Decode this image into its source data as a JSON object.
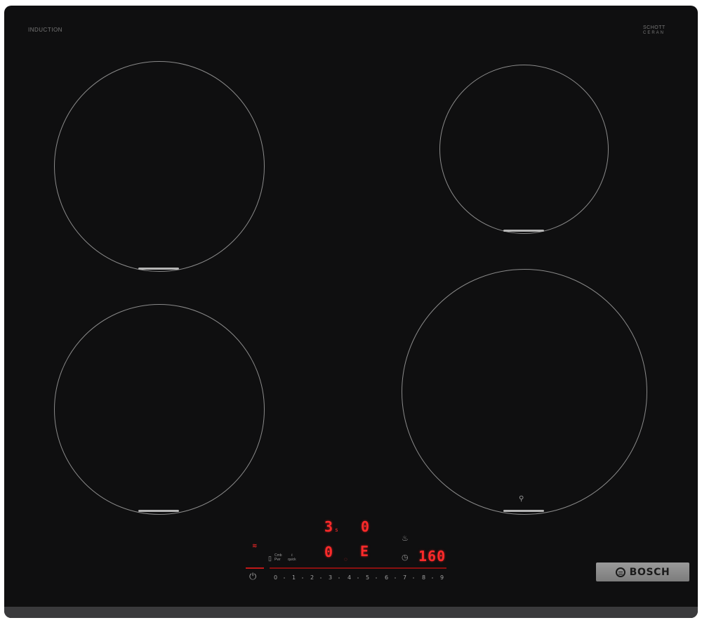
{
  "top_labels": {
    "left": "INDUCTION",
    "right_line1": "SCHOTT",
    "right_line2": "CERAN"
  },
  "displays": {
    "timer_left": "3",
    "timer_left_sub": "s",
    "timer_right": "0",
    "zone_level": "0",
    "error_code": "E",
    "timer_value": "160"
  },
  "control_labels": {
    "combi_label_top": "Cmb",
    "combi_label_bottom": "Pwr",
    "extra_label_top": "ℓ",
    "extra_label_bottom": "quick"
  },
  "power_levels": [
    "0",
    "1",
    "2",
    "3",
    "4",
    "5",
    "6",
    "7",
    "8",
    "9"
  ],
  "brand": {
    "name": "BOSCH"
  },
  "colors": {
    "display_red": "#ff2a2a",
    "glass_black": "#0f0f10",
    "zone_line": "#8a8a8a"
  }
}
